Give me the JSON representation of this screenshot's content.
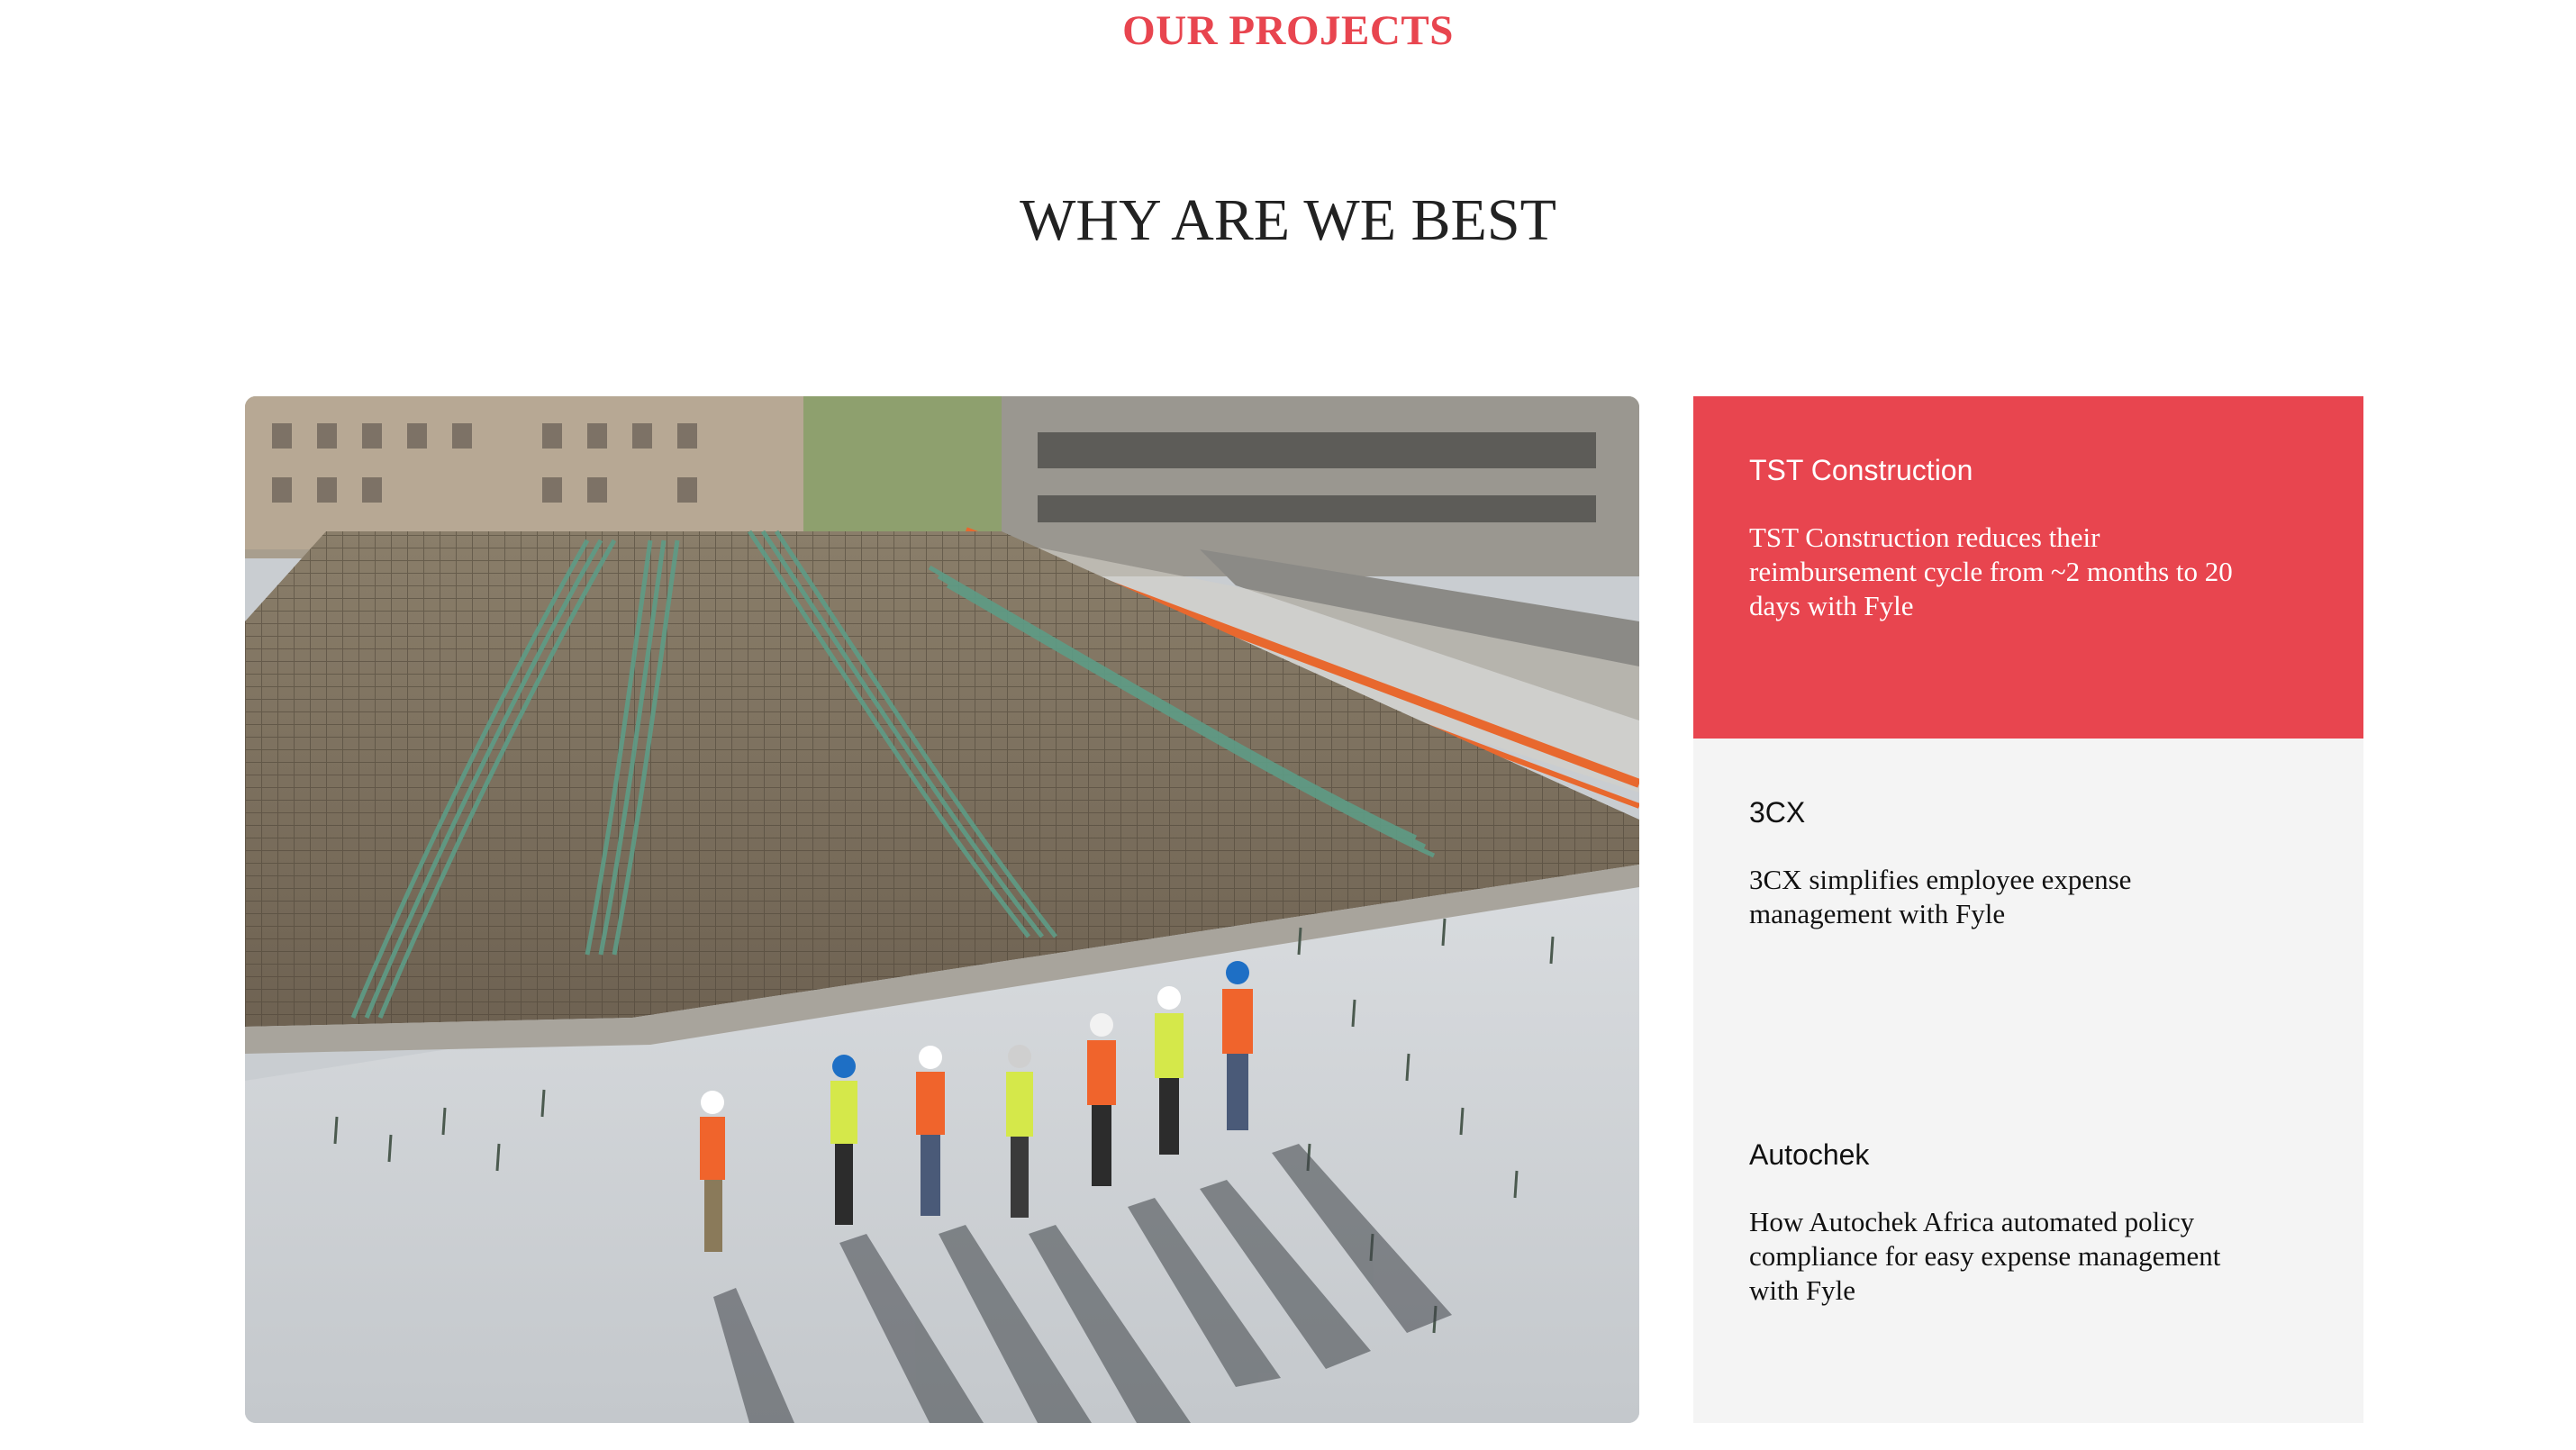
{
  "section": {
    "eyebrow": "OUR PROJECTS",
    "heading": "WHY ARE WE BEST"
  },
  "hero_image": {
    "description_icon": "construction-site-photo"
  },
  "projects": [
    {
      "name": "TST Construction",
      "summary": "TST Construction reduces their reimbursement cycle from ~2 months to 20 days with Fyle",
      "active": true
    },
    {
      "name": "3CX",
      "summary": "3CX simplifies employee expense management with Fyle",
      "active": false
    },
    {
      "name": "Autochek",
      "summary": "How Autochek Africa automated policy compliance for easy expense management with Fyle",
      "active": false
    }
  ],
  "colors": {
    "accent": "#e8454f",
    "card_inactive_bg": "#f4f4f4",
    "card_active_text": "#ffffff",
    "card_inactive_text": "#111111",
    "heading_text": "#222222"
  }
}
